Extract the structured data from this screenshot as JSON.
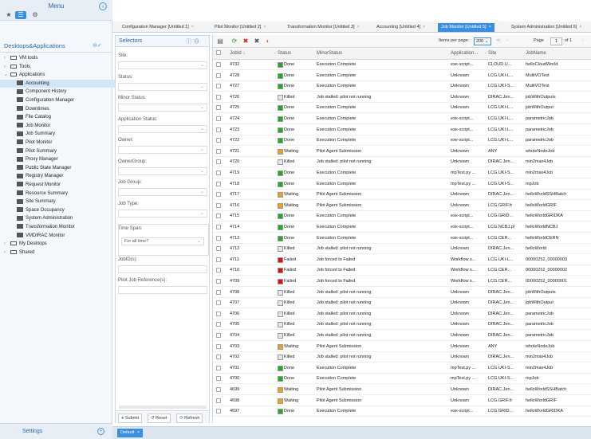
{
  "menu": {
    "title": "Menu",
    "collapse_icon": "arrow-left-circle-icon",
    "top_icons": [
      "pin-icon",
      "list-icon",
      "gear-icon"
    ]
  },
  "desktops": {
    "title": "Desktops&Applications",
    "tree": [
      {
        "label": "VM tools",
        "indent": 1,
        "type": "folder",
        "toggle": "+"
      },
      {
        "label": "Tools",
        "indent": 1,
        "type": "folder",
        "toggle": "+"
      },
      {
        "label": "Applications",
        "indent": 1,
        "type": "folder",
        "toggle": "-"
      },
      {
        "label": "Accounting",
        "indent": 2,
        "type": "app",
        "selected": true
      },
      {
        "label": "Component History",
        "indent": 2,
        "type": "app"
      },
      {
        "label": "Configuration Manager",
        "indent": 2,
        "type": "app"
      },
      {
        "label": "Downtimes",
        "indent": 2,
        "type": "app"
      },
      {
        "label": "File Catalog",
        "indent": 2,
        "type": "app"
      },
      {
        "label": "Job Monitor",
        "indent": 2,
        "type": "app"
      },
      {
        "label": "Job Summary",
        "indent": 2,
        "type": "app"
      },
      {
        "label": "Pilot Monitor",
        "indent": 2,
        "type": "app"
      },
      {
        "label": "Pilot Summary",
        "indent": 2,
        "type": "app"
      },
      {
        "label": "Proxy Manager",
        "indent": 2,
        "type": "app"
      },
      {
        "label": "Public State Manager",
        "indent": 2,
        "type": "app"
      },
      {
        "label": "Registry Manager",
        "indent": 2,
        "type": "app"
      },
      {
        "label": "Request Monitor",
        "indent": 2,
        "type": "app"
      },
      {
        "label": "Resource Summary",
        "indent": 2,
        "type": "app"
      },
      {
        "label": "Site Summary",
        "indent": 2,
        "type": "app"
      },
      {
        "label": "Space Occupancy",
        "indent": 2,
        "type": "app"
      },
      {
        "label": "System Administration",
        "indent": 2,
        "type": "app"
      },
      {
        "label": "Transformation Monitor",
        "indent": 2,
        "type": "app"
      },
      {
        "label": "VMDIRAC Monitor",
        "indent": 2,
        "type": "app"
      },
      {
        "label": "My Desktops",
        "indent": 1,
        "type": "folder",
        "toggle": "+"
      },
      {
        "label": "Shared",
        "indent": 1,
        "type": "folder",
        "toggle": "+"
      }
    ]
  },
  "settings": {
    "label": "Settings"
  },
  "tabs": [
    {
      "label": "Configuration Manager [Untitled 1]"
    },
    {
      "label": "Pilot Monitor [Untitled 2]"
    },
    {
      "label": "Transformation Monitor [Untitled 3]"
    },
    {
      "label": "Accounting [Untitled 4]"
    },
    {
      "label": "Job Monitor [Untitled 5]",
      "active": true
    },
    {
      "label": "System Administration [Untitled 6]"
    }
  ],
  "selectors": {
    "title": "Selectors",
    "fields": [
      {
        "label": "Site:",
        "value": ""
      },
      {
        "label": "Status:",
        "value": ""
      },
      {
        "label": "Minor Status:",
        "value": ""
      },
      {
        "label": "Application Status:",
        "value": ""
      },
      {
        "label": "Owner:",
        "value": ""
      },
      {
        "label": "OwnerGroup:",
        "value": ""
      },
      {
        "label": "Job Group:",
        "value": ""
      },
      {
        "label": "Job Type:",
        "value": ""
      }
    ],
    "timespan_label": "Time Span:",
    "timespan_value": "For all time?",
    "jobids_label": "JobID(s):",
    "pilot_ref_label": "Pilot Job Reference(s):",
    "submit": "Submit",
    "reset": "Reset",
    "refresh": "Refresh"
  },
  "grid": {
    "items_per_page_label": "Items per page:",
    "items_per_page": "200",
    "page_label": "Page",
    "page": "1",
    "of_label": "of 1",
    "columns": [
      "JobId",
      "Status",
      "MinorStatus",
      "Application...",
      "Site",
      "JobName"
    ],
    "status_colors": {
      "Done": "#22aa22",
      "Killed": "#e6e6e6",
      "Waiting": "#f0a020",
      "Failed": "#dd1111"
    },
    "rows": [
      [
        "4732",
        "Done",
        "Execution Complete",
        "exe-script...",
        "CLOUD.U...",
        "helloCloudWorld"
      ],
      [
        "4728",
        "Done",
        "Execution Complete",
        "Unknown",
        "LCG.UKI-L...",
        "MultiVOTest"
      ],
      [
        "4727",
        "Done",
        "Execution Complete",
        "Unknown",
        "LCG.UKI-S...",
        "MultiVOTest"
      ],
      [
        "4726",
        "Killed",
        "Job stalled: pilot not running",
        "Unknown",
        "DIRAC.Jen...",
        "jobWithOutputs"
      ],
      [
        "4725",
        "Done",
        "Execution Complete",
        "Unknown",
        "LCG.UKI-L...",
        "jobWithOutput"
      ],
      [
        "4724",
        "Done",
        "Execution Complete",
        "exe-script...",
        "LCG.UKI-L...",
        "parametricJob"
      ],
      [
        "4723",
        "Done",
        "Execution Complete",
        "exe-script...",
        "LCG.UKI-L...",
        "parametricJob"
      ],
      [
        "4722",
        "Done",
        "Execution Complete",
        "exe-script...",
        "LCG.UKI-L...",
        "parametricJob"
      ],
      [
        "4721",
        "Waiting",
        "Pilot Agent Submission",
        "Unknown",
        "ANY",
        "wholeNodeJob"
      ],
      [
        "4720",
        "Killed",
        "Job stalled: pilot not running",
        "Unknown",
        "DIRAC.Jen...",
        "min2max4Job"
      ],
      [
        "4719",
        "Done",
        "Execution Complete",
        "mpTest.py ...",
        "LCG.UKI-S...",
        "min2max4Job"
      ],
      [
        "4718",
        "Done",
        "Execution Complete",
        "mpTest.py ...",
        "LCG.UKI-S...",
        "mpJob"
      ],
      [
        "4717",
        "Waiting",
        "Pilot Agent Submission",
        "Unknown",
        "DIRAC.Jen...",
        "helloWorldSSHBatch"
      ],
      [
        "4716",
        "Waiting",
        "Pilot Agent Submission",
        "Unknown",
        "LCG.GRIF.fr",
        "helloWorldGRIF"
      ],
      [
        "4715",
        "Done",
        "Execution Complete",
        "exe-script...",
        "LCG.GRID...",
        "helloWorldGRIDKA"
      ],
      [
        "4714",
        "Done",
        "Execution Complete",
        "exe-script...",
        "LCG.NCBJ.pl",
        "helloWorldNCBJ"
      ],
      [
        "4713",
        "Done",
        "Execution Complete",
        "exe-script...",
        "LCG.CER...",
        "helloWorldCERN"
      ],
      [
        "4712",
        "Killed",
        "Job stalled: pilot not running",
        "Unknown",
        "DIRAC.Jen...",
        "helloWorld"
      ],
      [
        "4711",
        "Failed",
        "Job forced to Failed",
        "Workflow s...",
        "LCG.UKI-L...",
        "00000252_00000003"
      ],
      [
        "4710",
        "Failed",
        "Job forced to Failed",
        "Workflow s...",
        "LCG.CER...",
        "00000252_00000002"
      ],
      [
        "4709",
        "Failed",
        "Job forced to Failed",
        "Workflow s...",
        "LCG.CER...",
        "00000252_00000001"
      ],
      [
        "4708",
        "Killed",
        "Job stalled: pilot not running",
        "Unknown",
        "DIRAC.Jen...",
        "jobWithOutputs"
      ],
      [
        "4707",
        "Killed",
        "Job stalled: pilot not running",
        "Unknown",
        "DIRAC.Jen...",
        "jobWithOutput"
      ],
      [
        "4706",
        "Killed",
        "Job stalled: pilot not running",
        "Unknown",
        "DIRAC.Jen...",
        "parametricJob"
      ],
      [
        "4705",
        "Killed",
        "Job stalled: pilot not running",
        "Unknown",
        "DIRAC.Jen...",
        "parametricJob"
      ],
      [
        "4704",
        "Killed",
        "Job stalled: pilot not running",
        "Unknown",
        "DIRAC.Jen...",
        "parametricJob"
      ],
      [
        "4703",
        "Waiting",
        "Pilot Agent Submission",
        "Unknown",
        "ANY",
        "wholeNodeJob"
      ],
      [
        "4702",
        "Killed",
        "Job stalled: pilot not running",
        "Unknown",
        "DIRAC.Jen...",
        "min2max4Job"
      ],
      [
        "4701",
        "Done",
        "Execution Complete",
        "mpTest.py ...",
        "LCG.UKI-S...",
        "min2max4Job"
      ],
      [
        "4700",
        "Done",
        "Execution Complete",
        "mpTest.py ...",
        "LCG.UKI-S...",
        "mpJob"
      ],
      [
        "4699",
        "Waiting",
        "Pilot Agent Submission",
        "Unknown",
        "DIRAC.Jen...",
        "helloWorldSSHBatch"
      ],
      [
        "4698",
        "Waiting",
        "Pilot Agent Submission",
        "Unknown",
        "LCG.GRIF.fr",
        "helloWorldGRIF"
      ],
      [
        "4697",
        "Done",
        "Execution Complete",
        "exe-script...",
        "LCG.GRID...",
        "helloWorldGRIDKA"
      ]
    ]
  },
  "bottom": {
    "default_tab": "Default"
  }
}
